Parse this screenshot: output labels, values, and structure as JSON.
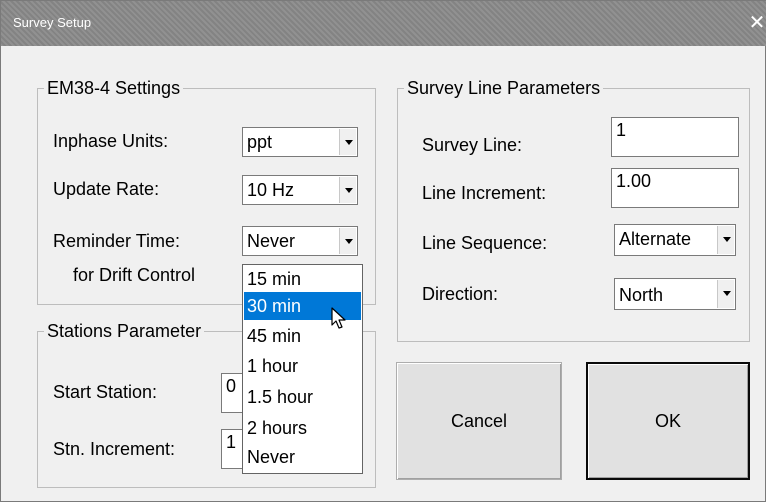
{
  "window": {
    "title": "Survey Setup",
    "close_glyph": "✕"
  },
  "em38": {
    "legend": "EM38-4 Settings",
    "inphase_label": "Inphase Units:",
    "inphase_value": "ppt",
    "update_label": "Update Rate:",
    "update_value": "10 Hz",
    "reminder_label": "Reminder Time:",
    "reminder_label2": "for Drift Control",
    "reminder_value": "Never"
  },
  "stations": {
    "legend": "Stations Parameter",
    "start_label": "Start Station:",
    "start_value": "0",
    "incr_label": "Stn. Increment:",
    "incr_value": "1"
  },
  "survey": {
    "legend": "Survey Line Parameters",
    "line_label": "Survey Line:",
    "line_value": "1",
    "incr_label": "Line Increment:",
    "incr_value": "1.00",
    "seq_label": "Line Sequence:",
    "seq_value": "Alternate",
    "dir_label": "Direction:",
    "dir_value": "North"
  },
  "buttons": {
    "cancel": "Cancel",
    "ok": "OK"
  },
  "dropdown": {
    "options": [
      "15 min",
      "30 min",
      "45 min",
      "1 hour",
      "1.5 hour",
      "2 hours",
      "Never"
    ],
    "highlighted": "30 min"
  },
  "colors": {
    "highlight": "#0078d7",
    "titlebar": "#8a8a8a",
    "dialog_bg": "#f0f0f0"
  }
}
